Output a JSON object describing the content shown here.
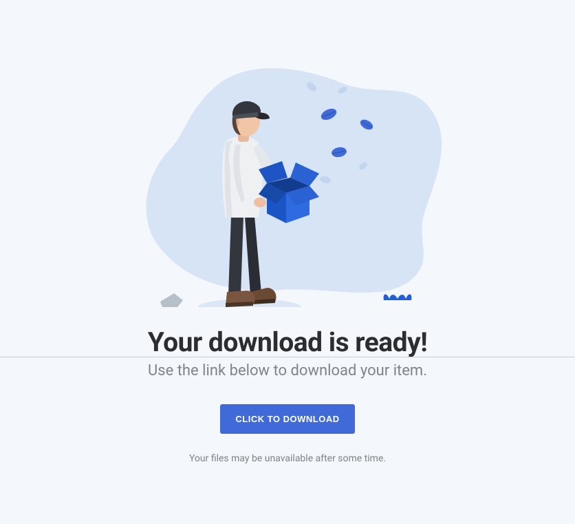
{
  "title": "Your download is ready!",
  "subtitle": "Use the link below to download your item.",
  "button_label": "CLICK TO DOWNLOAD",
  "note": "Your files may be unavailable after some time."
}
